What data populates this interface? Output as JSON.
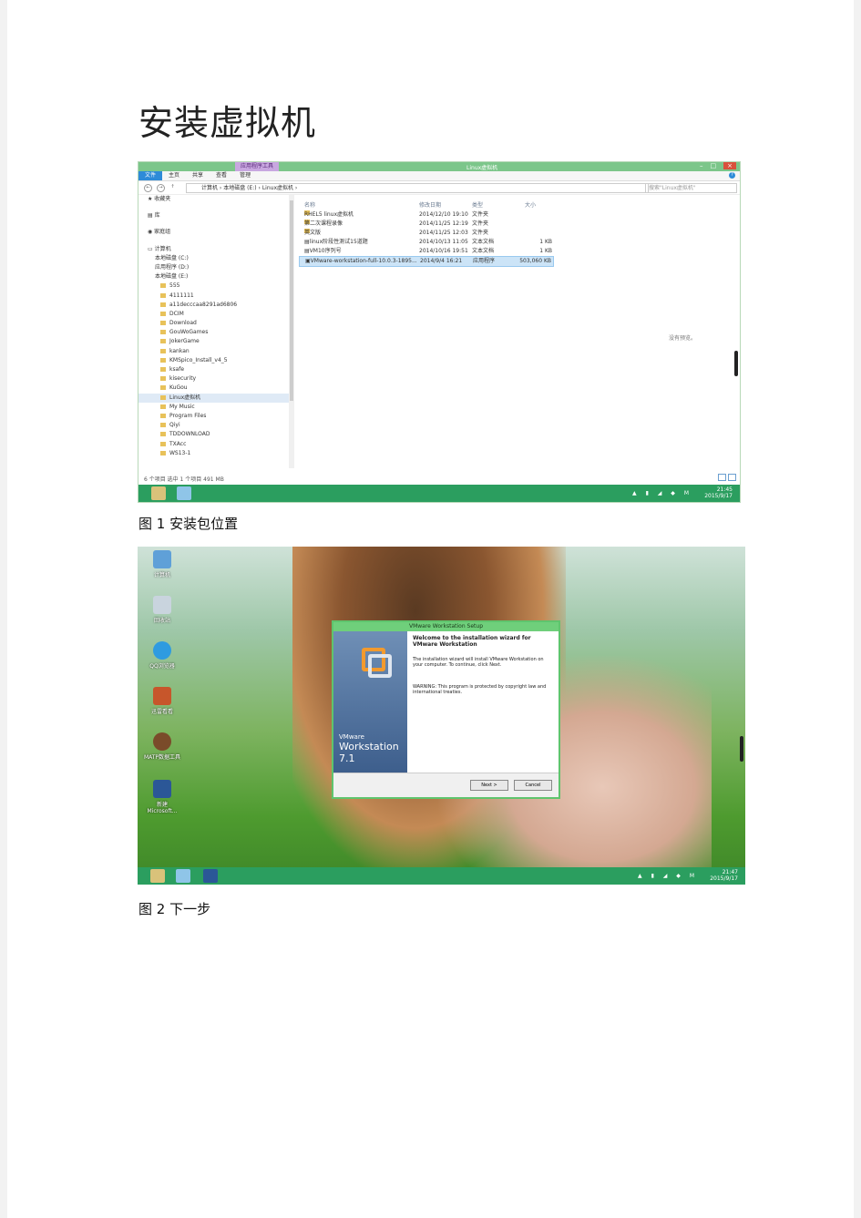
{
  "document": {
    "title": "安装虚拟机",
    "caption1": "图 1 安装包位置",
    "caption2": "图 2 下一步"
  },
  "explorer": {
    "window_title": "Linux虚拟机",
    "context_tab": "应用程序工具",
    "ribbon_tabs": [
      "文件",
      "主页",
      "共享",
      "查看",
      "管理"
    ],
    "address": "计算机 › 本地磁盘 (E:) › Linux虚拟机 ›",
    "search_placeholder": "搜索\"Linux虚拟机\"",
    "nav": {
      "favorites": "收藏夹",
      "library": "库",
      "homegroup": "家庭组",
      "computer": "计算机",
      "drives": [
        "本地磁盘 (C:)",
        "应用程序 (D:)",
        "本地磁盘 (E:)"
      ],
      "folders": [
        "555",
        "4111111",
        "a11decccaa8291ad6806",
        "DCIM",
        "Download",
        "GouWoGames",
        "JokerGame",
        "kankan",
        "KMSpico_Install_v4_5",
        "ksafe",
        "kisecurity",
        "KuGou",
        "Linux虚拟机",
        "My Music",
        "Program Files",
        "Qiyi",
        "TDDOWNLOAD",
        "TXAcc",
        "WS13-1"
      ]
    },
    "columns": [
      "名称",
      "修改日期",
      "类型",
      "大小"
    ],
    "files": [
      {
        "name": "RHEL5 linux虚拟机",
        "date": "2014/12/10 19:10",
        "type": "文件夹",
        "size": ""
      },
      {
        "name": "第二次课程录像",
        "date": "2014/11/25 12:19",
        "type": "文件夹",
        "size": ""
      },
      {
        "name": "英文版",
        "date": "2014/11/25 12:03",
        "type": "文件夹",
        "size": ""
      },
      {
        "name": "linux阶段性测试15道题",
        "date": "2014/10/13 11:05",
        "type": "文本文档",
        "size": "1 KB"
      },
      {
        "name": "VM10序列号",
        "date": "2014/10/16 19:51",
        "type": "文本文档",
        "size": "1 KB"
      },
      {
        "name": "VMware-workstation-full-10.0.3-1895...",
        "date": "2014/9/4 16:21",
        "type": "应用程序",
        "size": "503,060 KB"
      }
    ],
    "preview_text": "没有预览。",
    "status": "6 个项目   选中 1 个项目  491 MB",
    "clock_time": "21:45",
    "clock_date": "2015/9/17"
  },
  "desktop": {
    "icons": [
      {
        "label": "计算机"
      },
      {
        "label": "回收站"
      },
      {
        "label": "QQ浏览器"
      },
      {
        "label": "迅雷看看"
      },
      {
        "label": "MATP数据工具"
      },
      {
        "label": "新建 Microsoft..."
      }
    ],
    "dialog": {
      "title": "VMware Workstation Setup",
      "heading": "Welcome to the installation wizard for VMware Workstation",
      "body": "The installation wizard will install VMware Workstation on your computer. To continue, click Next.",
      "warning": "WARNING: This program is protected by copyright law and international treaties.",
      "brand": "VMware",
      "product": "Workstation 7.1",
      "next_label": "Next >",
      "cancel_label": "Cancel"
    },
    "clock_time": "21:47",
    "clock_date": "2015/9/17"
  },
  "colors": {
    "taskbar": "#2b9e5f",
    "accent": "#2e8bd8",
    "dialog_border": "#5fc46d"
  }
}
